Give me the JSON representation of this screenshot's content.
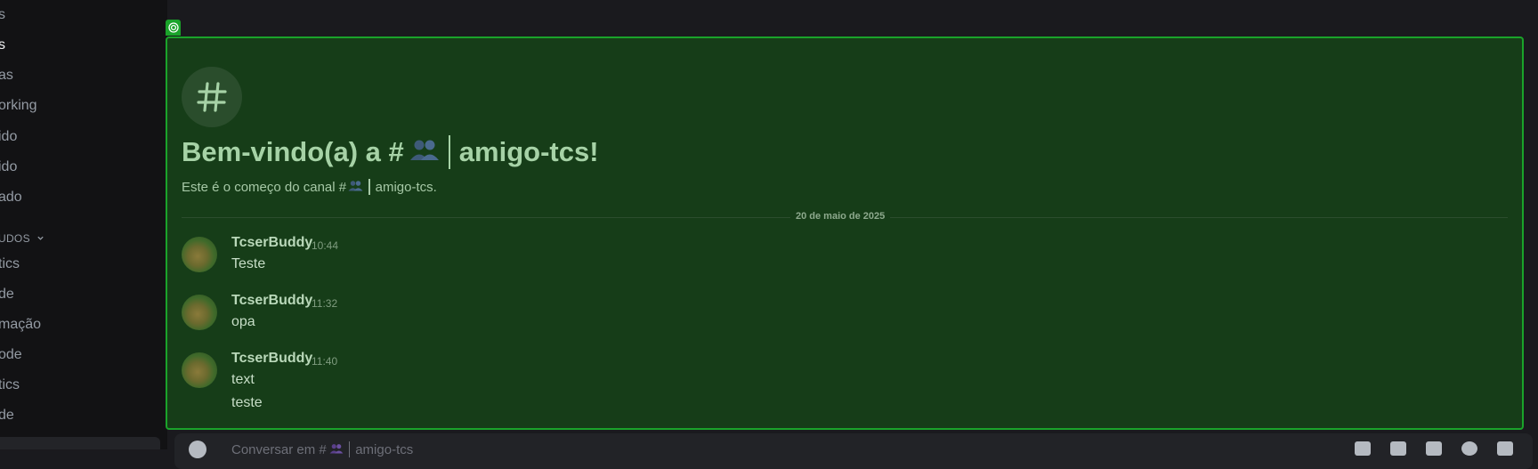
{
  "sidebar": {
    "items": [
      {
        "label": "s"
      },
      {
        "label": "s"
      },
      {
        "label": "as"
      },
      {
        "label": "orking"
      },
      {
        "label": "ido"
      },
      {
        "label": "ido"
      },
      {
        "label": "ado"
      },
      {
        "label": "tics"
      },
      {
        "label": "de"
      },
      {
        "label": "mação"
      },
      {
        "label": "ode"
      },
      {
        "label": "tics"
      },
      {
        "label": "de"
      }
    ],
    "category_label": "UDOS"
  },
  "welcome": {
    "title_prefix": "Bem-vindo(a) a #",
    "title_channel": "amigo-tcs!",
    "subtitle_prefix": "Este é o começo do canal #",
    "subtitle_channel": "amigo-tcs."
  },
  "divider": {
    "date": "20 de maio de 2025"
  },
  "messages": [
    {
      "author": "TcserBuddy",
      "time": "10:44",
      "lines": [
        "Teste"
      ]
    },
    {
      "author": "TcserBuddy",
      "time": "11:32",
      "lines": [
        "opa"
      ]
    },
    {
      "author": "TcserBuddy",
      "time": "11:40",
      "lines": [
        "text",
        "teste"
      ]
    }
  ],
  "composer": {
    "placeholder_prefix": "Conversar em #",
    "placeholder_channel": "amigo-tcs"
  },
  "icons": {
    "overlay_badge": "target-icon",
    "channel": "hash-icon",
    "channel_emoji": "people-icon",
    "category": "chevron-down-icon",
    "composer_add": "plus-circle-icon",
    "composer_tools": [
      "gift-icon",
      "gif-icon",
      "sticker-icon",
      "emoji-icon",
      "apps-icon"
    ]
  },
  "colors": {
    "overlay_fill": "#163d18",
    "overlay_border": "#1aa32a",
    "background": "#1a1a1e",
    "sidebar": "#121214"
  }
}
